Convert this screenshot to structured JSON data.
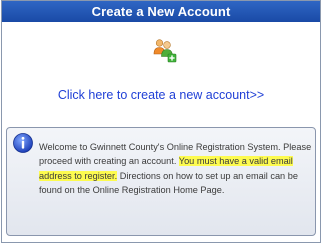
{
  "header": {
    "title": "Create a New Account"
  },
  "main": {
    "icon": "add-user-icon",
    "create_link": "Click here to create a new account>>"
  },
  "info": {
    "icon": "info-icon",
    "text_before": "Welcome to Gwinnett County's Online Registration System. Please proceed with creating an account.",
    "text_highlight": "You must have a valid email address to register.",
    "text_after": "Directions on how to set up an email can be found on the Online Registration Home Page."
  },
  "colors": {
    "header_bg": "#1f4fae",
    "link": "#1f3fd6",
    "highlight": "#fdfb4f"
  }
}
